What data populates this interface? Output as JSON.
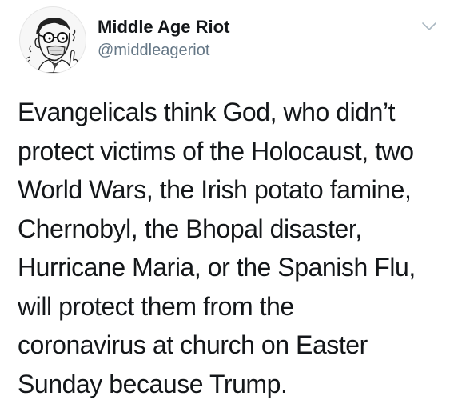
{
  "tweet": {
    "author": {
      "display_name": "Middle Age Riot",
      "handle": "@middleageriot",
      "avatar_icon": "sketch-man-with-glasses-avatar"
    },
    "menu_icon": "chevron-down-icon",
    "text_lines": [
      "Evangelicals think God, who didn’t",
      "protect victims of the Holocaust, two",
      "World Wars, the Irish potato famine,",
      "Chernobyl, the Bhopal disaster,",
      "Hurricane Maria, or the Spanish Flu,",
      "will protect them from the",
      "coronavirus at church on Easter",
      "Sunday because Trump."
    ]
  },
  "colors": {
    "text": "#14171a",
    "secondary_text": "#657786",
    "icon": "#aab8c2",
    "background": "#ffffff"
  }
}
